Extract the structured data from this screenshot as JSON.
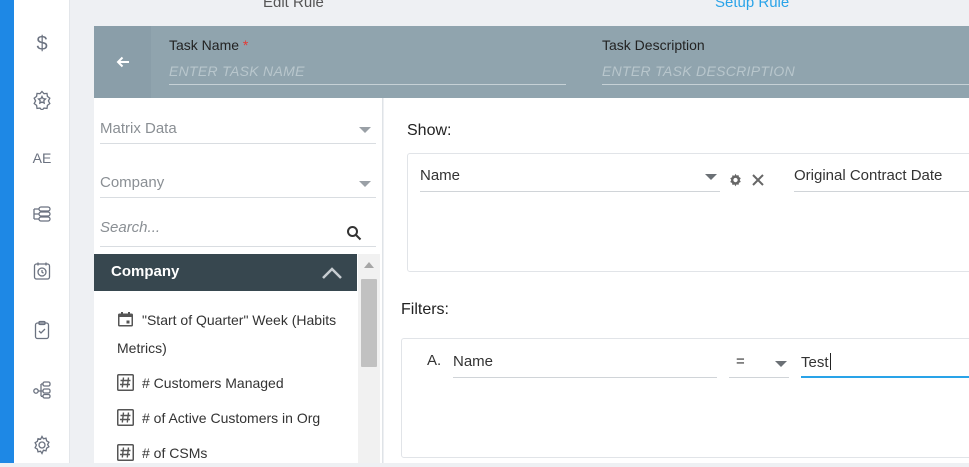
{
  "tabs": {
    "edit": "Edit Rule",
    "setup": "Setup Rule"
  },
  "header": {
    "back_icon": "arrow-left-icon",
    "task_name_label": "Task Name",
    "required_mark": "*",
    "task_name_placeholder": "ENTER TASK NAME",
    "task_desc_label": "Task Description",
    "task_desc_placeholder": "ENTER TASK DESCRIPTION"
  },
  "sidebar": {
    "items": [
      {
        "icon": "dollar-icon",
        "text": "$"
      },
      {
        "icon": "badge-star-icon"
      },
      {
        "icon": "ae-icon",
        "text": "AE"
      },
      {
        "icon": "list-tree-icon"
      },
      {
        "icon": "clock-calendar-icon"
      },
      {
        "icon": "clipboard-check-icon"
      },
      {
        "icon": "hierarchy-icon"
      },
      {
        "icon": "gear-icon"
      }
    ]
  },
  "left_panel": {
    "source_select": "Matrix Data",
    "object_select": "Company",
    "search_placeholder": "Search...",
    "group_title": "Company",
    "fields": [
      {
        "icon": "calendar-icon",
        "label": "\"Start of Quarter\" Week (Habits Metrics)"
      },
      {
        "icon": "number-icon",
        "label": "# Customers Managed"
      },
      {
        "icon": "number-icon",
        "label": "# of Active Customers in Org"
      },
      {
        "icon": "number-icon",
        "label": "# of CSMs"
      }
    ]
  },
  "show": {
    "title": "Show:",
    "field1": "Name",
    "field2": "Original Contract Date"
  },
  "filters": {
    "title": "Filters:",
    "rows": [
      {
        "letter": "A.",
        "field": "Name",
        "operator": "=",
        "value": "Test"
      }
    ]
  },
  "colors": {
    "accent": "#29a3e8",
    "header_bg": "#90a4ae",
    "group_bg": "#37474f",
    "rail": "#1e88e5"
  }
}
